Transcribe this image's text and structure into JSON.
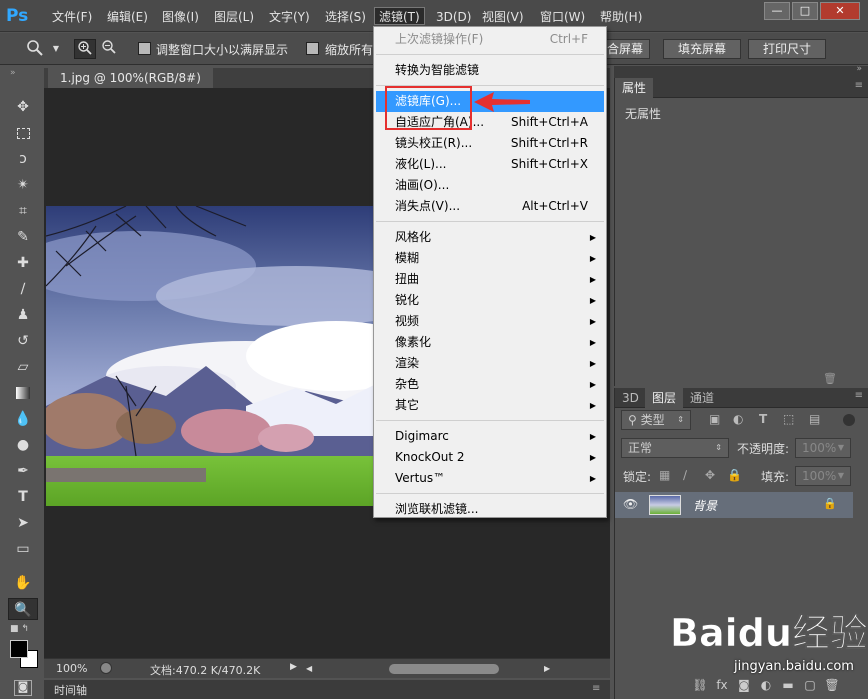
{
  "menubar": {
    "logo": "Ps",
    "items": [
      "文件(F)",
      "编辑(E)",
      "图像(I)",
      "图层(L)",
      "文字(Y)",
      "选择(S)",
      "滤镜(T)",
      "3D(D)",
      "视图(V)",
      "窗口(W)",
      "帮助(H)"
    ],
    "window_buttons": [
      "—",
      "□",
      "✕"
    ]
  },
  "options": {
    "resize_window": "调整窗口大小以满屏显示",
    "zoom_all": "缩放所有",
    "buttons": [
      "合屏幕",
      "填充屏幕",
      "打印尺寸"
    ]
  },
  "document": {
    "tab_title": "1.jpg @ 100%(RGB/8#)",
    "zoom": "100%",
    "doc_info": "文档:470.2 K/470.2K",
    "timeline": "时间轴"
  },
  "properties": {
    "tab": "属性",
    "empty": "无属性"
  },
  "layers": {
    "tabs": [
      "3D",
      "图层",
      "通道"
    ],
    "kind": "类型",
    "blend_mode": "正常",
    "opacity_label": "不透明度:",
    "opacity_value": "100%",
    "lock_label": "锁定:",
    "fill_label": "填充:",
    "fill_value": "100%",
    "layer_name": "背景"
  },
  "filter_menu": {
    "items": [
      {
        "label": "上次滤镜操作(F)",
        "shortcut": "Ctrl+F",
        "disabled": true
      },
      {
        "label": "转换为智能滤镜"
      },
      {
        "label": "滤镜库(G)...",
        "highlighted": true
      },
      {
        "label": "自适应广角(A)...",
        "shortcut": "Shift+Ctrl+A"
      },
      {
        "label": "镜头校正(R)...",
        "shortcut": "Shift+Ctrl+R"
      },
      {
        "label": "液化(L)...",
        "shortcut": "Shift+Ctrl+X"
      },
      {
        "label": "油画(O)..."
      },
      {
        "label": "消失点(V)...",
        "shortcut": "Alt+Ctrl+V"
      },
      {
        "label": "风格化",
        "submenu": true
      },
      {
        "label": "模糊",
        "submenu": true
      },
      {
        "label": "扭曲",
        "submenu": true
      },
      {
        "label": "锐化",
        "submenu": true
      },
      {
        "label": "视频",
        "submenu": true
      },
      {
        "label": "像素化",
        "submenu": true
      },
      {
        "label": "渲染",
        "submenu": true
      },
      {
        "label": "杂色",
        "submenu": true
      },
      {
        "label": "其它",
        "submenu": true
      },
      {
        "label": "Digimarc",
        "submenu": true
      },
      {
        "label": "KnockOut 2",
        "submenu": true
      },
      {
        "label": "Vertus™",
        "submenu": true
      },
      {
        "label": "浏览联机滤镜..."
      }
    ]
  },
  "watermark": {
    "brand": "Baidu经验",
    "url": "jingyan.baidu.com"
  },
  "colors": {
    "accent": "#3399ff",
    "annotation": "#e5302f"
  }
}
